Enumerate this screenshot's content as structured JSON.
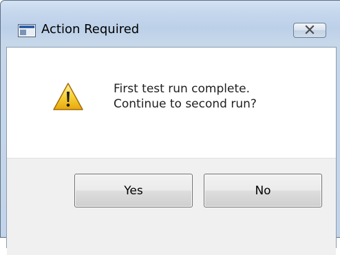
{
  "window": {
    "title": "Action Required",
    "icon": "window-app-icon",
    "close_icon": "close-icon"
  },
  "dialog": {
    "icon": "warning-icon",
    "message_line1": "First test run complete.",
    "message_line2": "Continue to second run?"
  },
  "buttons": {
    "yes_label": "Yes",
    "no_label": "No"
  },
  "colors": {
    "frame": "#c4d6ec",
    "button_area": "#f0f0f0",
    "warning_yellow": "#f5c518"
  }
}
